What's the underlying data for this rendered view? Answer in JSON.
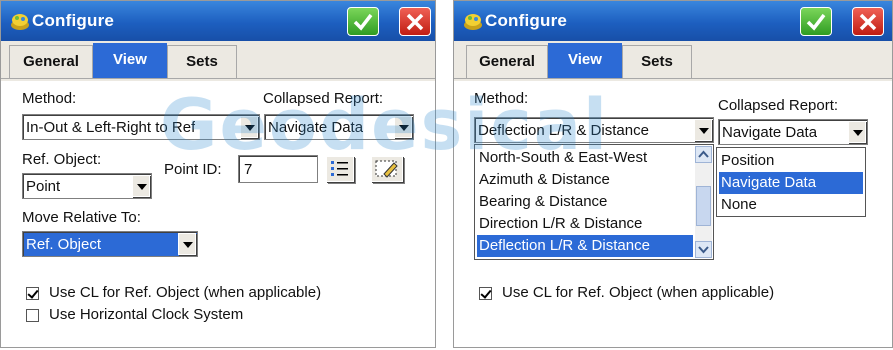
{
  "colors": {
    "title_bar": "#1d5fc0",
    "active_tab": "#2c6ad6",
    "selection": "#2c6ad6",
    "ok_button": "#2f9c22",
    "cancel_button": "#c01d12",
    "panel_bg": "#ece9e2"
  },
  "watermark": "Geodesical",
  "left_dialog": {
    "title": "Configure",
    "tabs": [
      "General",
      "View",
      "Sets"
    ],
    "active_tab": "View",
    "method_label": "Method:",
    "method_value": "In-Out & Left-Right to Ref",
    "collapsed_report_label": "Collapsed Report:",
    "collapsed_report_value": "Navigate Data",
    "ref_object_label": "Ref. Object:",
    "ref_object_value": "Point",
    "point_id_label": "Point ID:",
    "point_id_value": "7",
    "move_relative_label": "Move Relative To:",
    "move_relative_value": "Ref. Object",
    "use_cl_label": "Use CL for Ref. Object (when applicable)",
    "use_cl_checked": true,
    "horizontal_clock_label": "Use Horizontal Clock System",
    "horizontal_clock_checked": false
  },
  "right_dialog": {
    "title": "Configure",
    "tabs": [
      "General",
      "View",
      "Sets"
    ],
    "active_tab": "View",
    "method_label": "Method:",
    "method_value": "Deflection L/R & Distance",
    "method_options": [
      "North-South & East-West",
      "Azimuth & Distance",
      "Bearing & Distance",
      "Direction L/R & Distance",
      "Deflection L/R & Distance"
    ],
    "method_selected_index": 4,
    "collapsed_report_label": "Collapsed Report:",
    "collapsed_report_value": "Navigate Data",
    "collapsed_report_options": [
      "Position",
      "Navigate Data",
      "None"
    ],
    "collapsed_report_selected_index": 1,
    "use_cl_label": "Use CL for Ref. Object (when applicable)",
    "use_cl_checked": true
  }
}
